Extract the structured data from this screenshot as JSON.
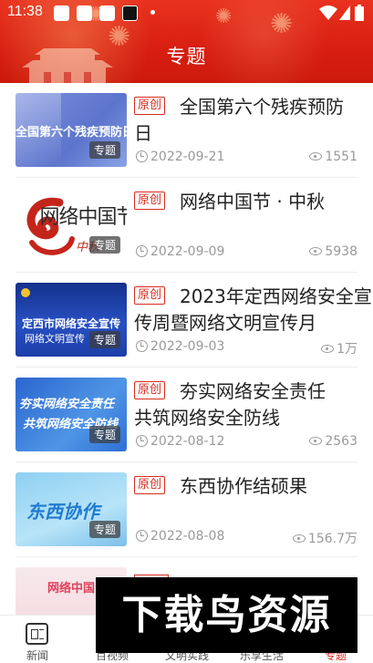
{
  "status_bar": {
    "time": "11:38"
  },
  "header": {
    "title": "专题"
  },
  "articles": [
    {
      "thumb_text": "全国第六个残疾预防日",
      "thumb_colors": [
        "#6f86d8",
        "#5f78cf"
      ],
      "tag": "专题",
      "badge": "原创",
      "title": "全国第六个残疾预防日",
      "date": "2022-09-21",
      "views": "1551"
    },
    {
      "thumb_text": "网络中国节",
      "thumb_subtext": "中秋",
      "thumb_colors": [
        "#ffffff",
        "#ffffff"
      ],
      "tag": "专题",
      "badge": "原创",
      "title": "网络中国节 · 中秋",
      "date": "2022-09-09",
      "views": "5938"
    },
    {
      "thumb_text": "定西市网络安全宣传",
      "thumb_subtext": "网络文明宣传",
      "thumb_colors": [
        "#1b3d9e",
        "#2d58c9"
      ],
      "tag": "专题",
      "badge": "原创",
      "title": "2023年定西网络安全宣传周暨网络文明宣传月",
      "date": "2022-09-03",
      "views": "1万"
    },
    {
      "thumb_text": "夯实网络安全责任",
      "thumb_subtext": "共筑网络安全防线",
      "thumb_colors": [
        "#2f74d6",
        "#4a92e8"
      ],
      "tag": "专题",
      "badge": "原创",
      "title": "夯实网络安全责任 共筑网络安全防线",
      "date": "2022-08-12",
      "views": "2563"
    },
    {
      "thumb_text": "东西协作",
      "thumb_colors": [
        "#7fc4ee",
        "#a9dcf6"
      ],
      "tag": "专题",
      "badge": "原创",
      "title": "东西协作结硕果",
      "date": "2022-08-08",
      "views": "156.7万"
    }
  ],
  "peek_item": {
    "thumb_text": "网络中国"
  },
  "bottom_nav": {
    "items": [
      {
        "label": "新闻"
      },
      {
        "label": "百视频"
      },
      {
        "label": "文明实践"
      },
      {
        "label": "乐享生活"
      },
      {
        "label": "专题"
      }
    ]
  },
  "watermark": {
    "text": "下载鸟资源"
  },
  "colors": {
    "accent": "#d92b1f",
    "header": "#e02a1b"
  }
}
